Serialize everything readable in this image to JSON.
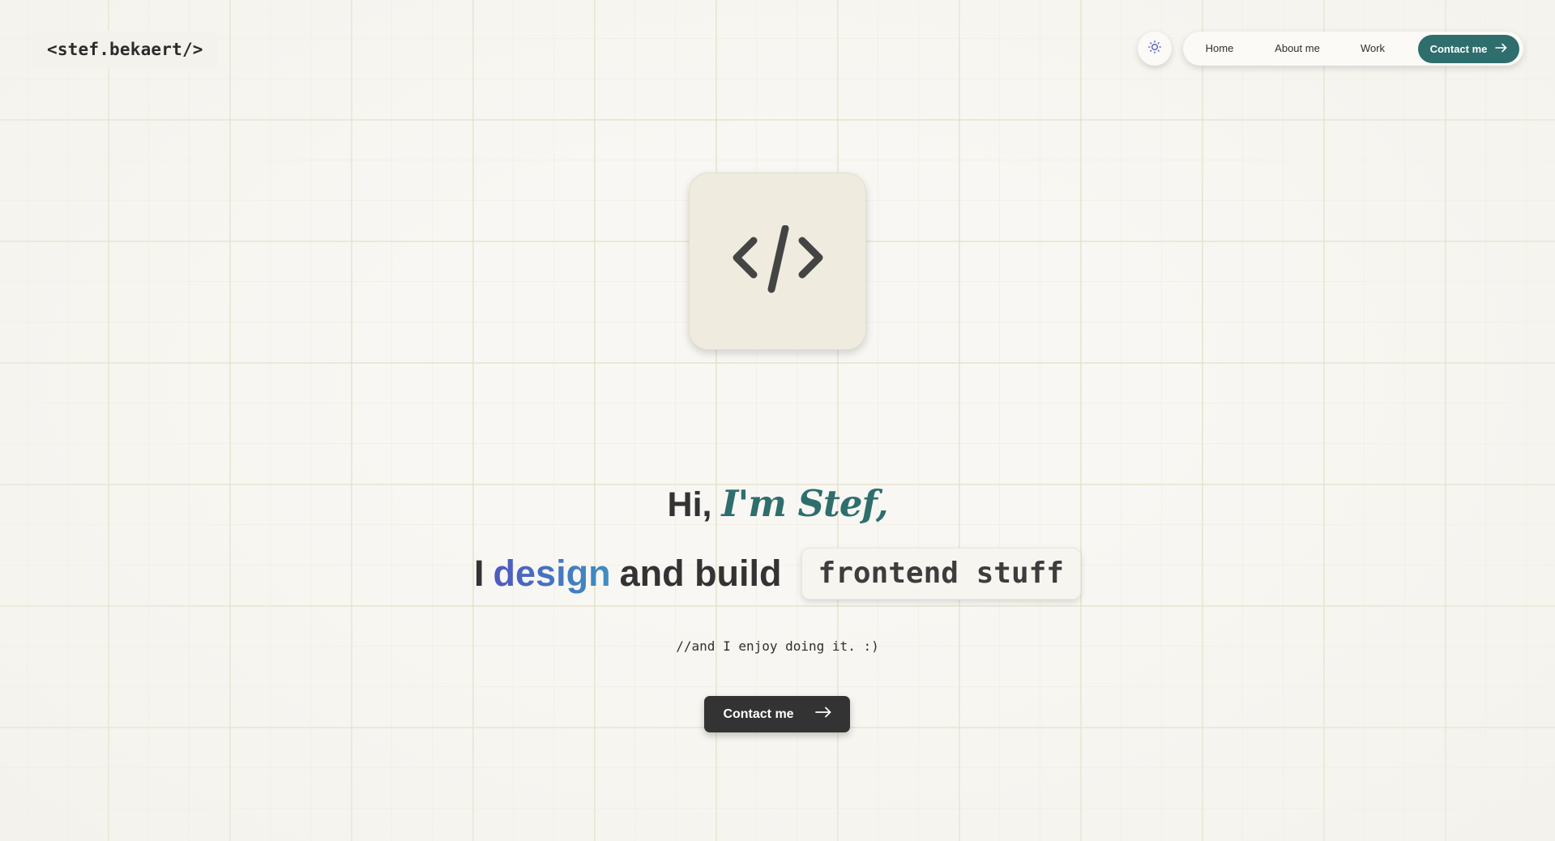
{
  "header": {
    "logo_text": "<stef.bekaert/>",
    "theme_toggle_icon": "sun-icon"
  },
  "nav": {
    "items": [
      {
        "label": "Home"
      },
      {
        "label": "About me"
      },
      {
        "label": "Work"
      }
    ],
    "contact_label": "Contact me",
    "contact_icon": "arrow-right-icon",
    "accent_color": "#2e6e6d"
  },
  "hero": {
    "icon": "code-icon",
    "greeting": "Hi,",
    "name": "I'm Stef,",
    "line2_prefix": "I",
    "line2_highlight": "design",
    "line2_middle": "and build",
    "code_chip": "frontend stuff",
    "subtitle": "//and I enjoy doing it. :)",
    "cta_label": "Contact me",
    "cta_icon": "arrow-right-icon",
    "gradient_colors": [
      "#4f59bf",
      "#3e90c0"
    ]
  }
}
